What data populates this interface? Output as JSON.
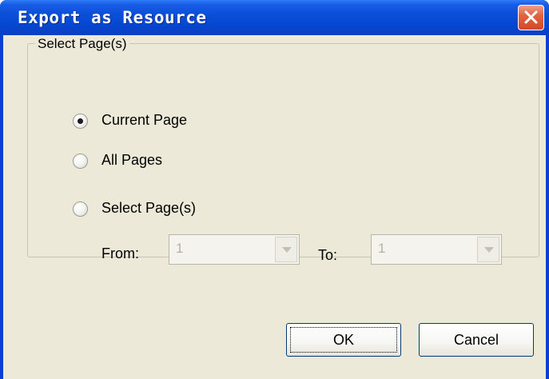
{
  "window": {
    "title": "Export as Resource"
  },
  "group": {
    "legend": "Select Page(s)"
  },
  "radios": [
    {
      "label": "Current Page",
      "selected": true
    },
    {
      "label": "All Pages",
      "selected": false
    },
    {
      "label": "Select Page(s)",
      "selected": false
    }
  ],
  "range": {
    "from_label": "From:",
    "from_value": "1",
    "to_label": "To:",
    "to_value": "1"
  },
  "buttons": {
    "ok": "OK",
    "cancel": "Cancel"
  },
  "colors": {
    "titlebar": "#0547d1",
    "client_bg": "#ece9d8",
    "close_button": "#d24a26"
  },
  "icons": {
    "close": "close-icon",
    "combo_arrow": "chevron-down-icon"
  }
}
